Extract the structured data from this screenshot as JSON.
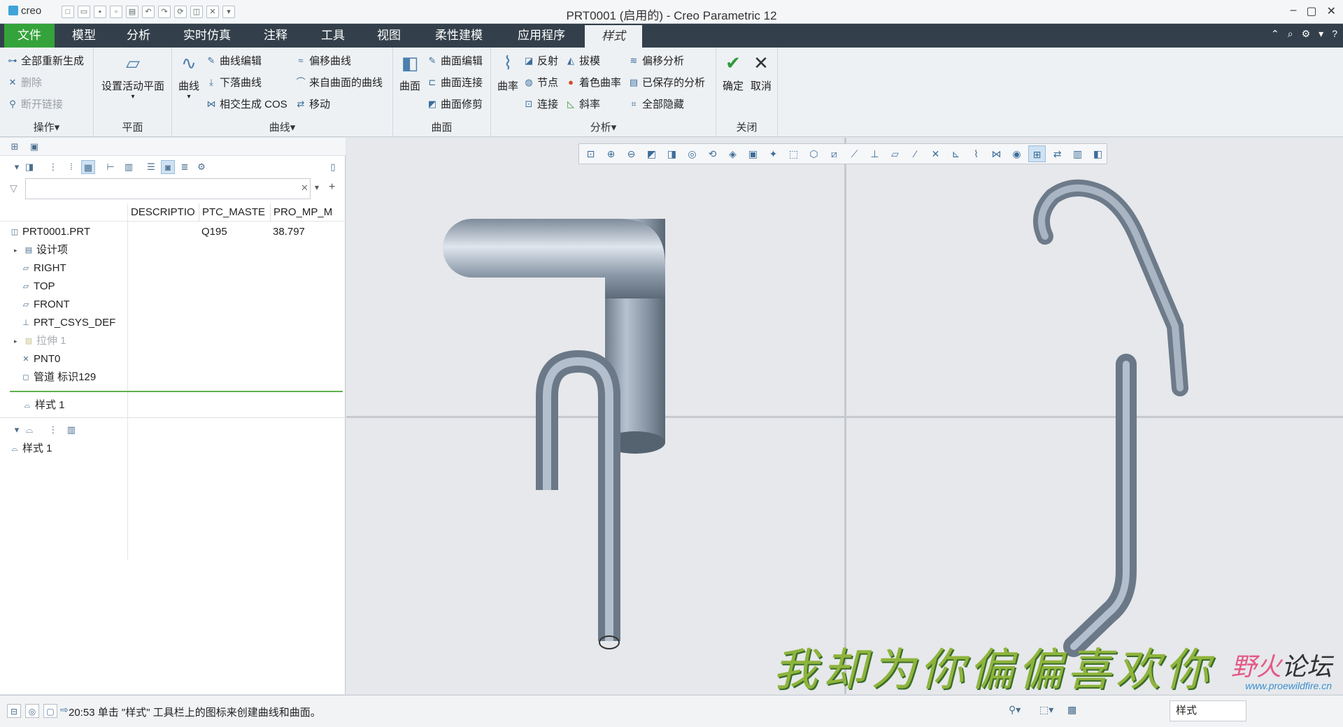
{
  "app": {
    "logo": "creo",
    "title": "PRT0001 (启用的) - Creo Parametric 12"
  },
  "ribbon_tabs": [
    "文件",
    "模型",
    "分析",
    "实时仿真",
    "注释",
    "工具",
    "视图",
    "柔性建模",
    "应用程序",
    "样式"
  ],
  "ribbon": {
    "ops": {
      "title": "操作",
      "regen": "全部重新生成",
      "delete": "删除",
      "break_link": "断开链接"
    },
    "plane": {
      "title": "平面",
      "set_active": "设置活动平面"
    },
    "curves": {
      "title": "曲线",
      "curve": "曲线",
      "curve_edit": "曲线编辑",
      "drop_curve": "下落曲线",
      "intersect_cos": "相交生成 COS",
      "offset_curve": "偏移曲线",
      "from_surface": "来自曲面的曲线",
      "move": "移动"
    },
    "surfaces": {
      "title": "曲面",
      "surface": "曲面",
      "surface_edit": "曲面编辑",
      "surface_connect": "曲面连接",
      "surface_trim": "曲面修剪"
    },
    "analysis": {
      "title": "分析",
      "curvature": "曲率",
      "reflect": "反射",
      "node": "节点",
      "connect": "连接",
      "draft": "拔模",
      "shade_curv": "着色曲率",
      "slope": "斜率",
      "offset_analysis": "偏移分析",
      "saved_analysis": "已保存的分析",
      "hide_all": "全部隐藏"
    },
    "close": {
      "title": "关闭",
      "ok": "确定",
      "cancel": "取消"
    }
  },
  "tree": {
    "filter_placeholder": "",
    "columns": [
      "DESCRIPTIO",
      "PTC_MASTE",
      "PRO_MP_M"
    ],
    "rows": [
      {
        "name": "PRT0001.PRT",
        "c2": "Q195",
        "c3": "38.797"
      },
      {
        "name": "设计项",
        "c2": "",
        "c3": ""
      },
      {
        "name": "RIGHT",
        "c2": "",
        "c3": ""
      },
      {
        "name": "TOP",
        "c2": "",
        "c3": ""
      },
      {
        "name": "FRONT",
        "c2": "",
        "c3": ""
      },
      {
        "name": "PRT_CSYS_DEF",
        "c2": "",
        "c3": ""
      },
      {
        "name": "拉伸 1",
        "c2": "",
        "c3": ""
      },
      {
        "name": "PNT0",
        "c2": "",
        "c3": ""
      },
      {
        "name": "管道 标识129",
        "c2": "",
        "c3": ""
      },
      {
        "name": "样式 1",
        "c2": "",
        "c3": ""
      }
    ],
    "style_tree_root": "样式 1"
  },
  "overlay_caption": "我却为你偏偏喜欢你",
  "watermark": {
    "line1a": "野火",
    "line1b": "论坛",
    "line2": "www.proewildfire.cn"
  },
  "status": {
    "message": "20:53 单击 \"样式\" 工具栏上的图标来创建曲线和曲面。",
    "filter": "样式"
  },
  "colors": {
    "tab_bar": "#33404b",
    "file_tab": "#35a33b",
    "tube": "#8a98a8",
    "viewport_bg": "#e6e8eb"
  }
}
